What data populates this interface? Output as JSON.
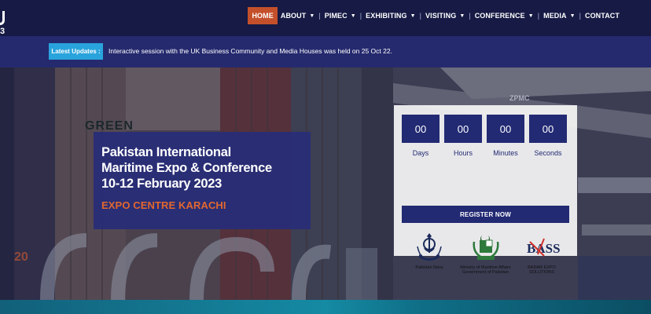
{
  "header": {
    "logo_digit": "3",
    "nav": [
      {
        "label": "HOME",
        "active": true,
        "caret": false
      },
      {
        "label": "ABOUT",
        "active": false,
        "caret": true
      },
      {
        "label": "PIMEC",
        "active": false,
        "caret": true
      },
      {
        "label": "EXHIBITING",
        "active": false,
        "caret": true
      },
      {
        "label": "VISITING",
        "active": false,
        "caret": true
      },
      {
        "label": "CONFERENCE",
        "active": false,
        "caret": true
      },
      {
        "label": "MEDIA",
        "active": false,
        "caret": true
      },
      {
        "label": "CONTACT",
        "active": false,
        "caret": false
      }
    ],
    "caret_glyph": "▼",
    "separator": "|"
  },
  "updates": {
    "label": "Latest Updates :",
    "text": "Interactive session with the UK Business Community and Media Houses was held on 25 Oct 22."
  },
  "hero": {
    "title_lines": [
      "Pakistan International",
      "Maritime Expo & Conference",
      "10-12 February 2023"
    ],
    "venue": "EXPO CENTRE KARACHI",
    "bg_text": {
      "green": "GREEN",
      "zpmc": "ZPMC",
      "number": "20"
    }
  },
  "countdown": {
    "units": [
      {
        "value": "00",
        "label": "Days"
      },
      {
        "value": "00",
        "label": "Hours"
      },
      {
        "value": "00",
        "label": "Minutes"
      },
      {
        "value": "00",
        "label": "Seconds"
      }
    ],
    "register_label": "REGISTER NOW"
  },
  "sponsors": {
    "navy": {
      "caption": "Pakistan Navy"
    },
    "ministry": {
      "caption_line1": "Ministry of Maritime Affairs",
      "caption_line2": "Government of Pakistan"
    },
    "badar": {
      "logo_text": "BASS",
      "caption_line1": "BADAR EXPO",
      "caption_line2": "SOLUTIONS"
    }
  },
  "colors": {
    "header_bg": "#161a44",
    "active_nav": "#c4502b",
    "updates_bg": "#252a6e",
    "updates_label": "#29a3dc",
    "card_navy": "#222a73",
    "venue_orange": "#e2672f"
  }
}
